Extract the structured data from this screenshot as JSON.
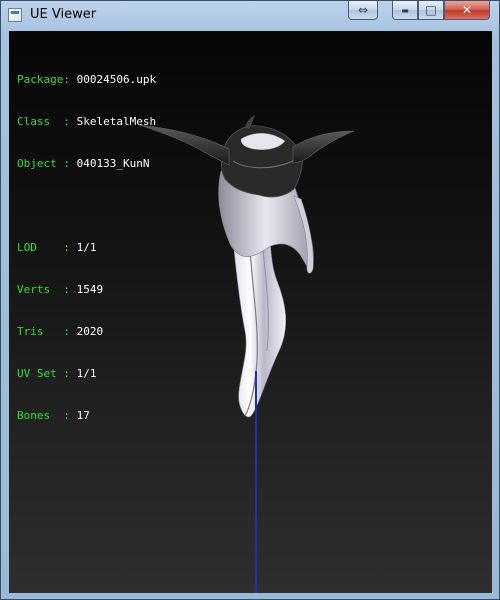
{
  "window": {
    "title": "UE Viewer"
  },
  "caption_buttons": {
    "restore_icon": "⇔",
    "minimize_icon": "▬",
    "maximize_icon": "□",
    "close_icon": "✕"
  },
  "info": {
    "package_label": "Package:",
    "package_value": "00024506.upk",
    "class_label": "Class  :",
    "class_value": "SkeletalMesh",
    "object_label": "Object :",
    "object_value": "040133_KunN",
    "lod_label": "LOD    :",
    "lod_value": "1/1",
    "verts_label": "Verts  :",
    "verts_value": "1549",
    "tris_label": "Tris   :",
    "tris_value": "2020",
    "uvset_label": "UV Set :",
    "uvset_value": "1/1",
    "bones_label": "Bones  :",
    "bones_value": "17"
  },
  "colors": {
    "label_green": "#2ee02e",
    "value_white": "#ffffff",
    "bone_blue": "#1f2fb8",
    "close_red": "#c0392b"
  }
}
